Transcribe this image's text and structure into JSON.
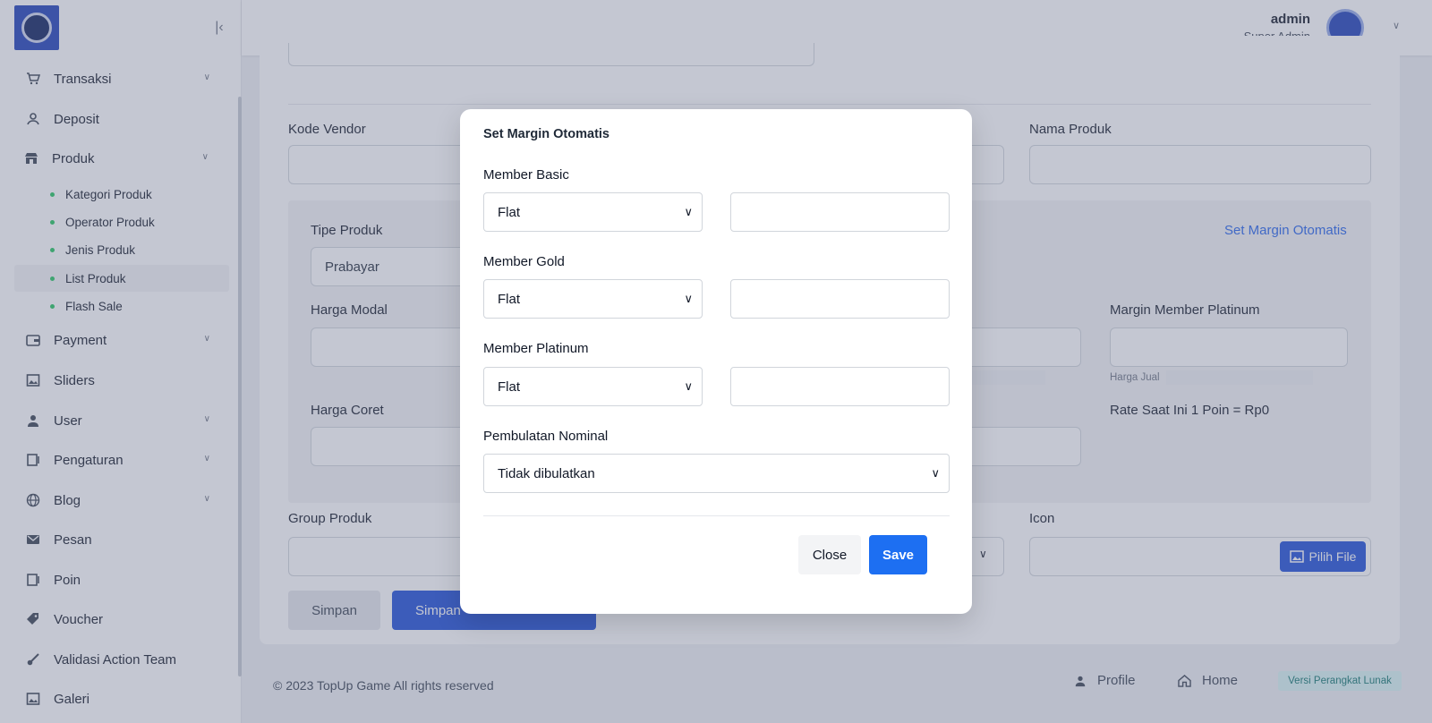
{
  "header": {
    "user_name": "admin",
    "user_role": "Super Admin"
  },
  "sidebar": {
    "items": [
      {
        "label": "Transaksi",
        "icon": "cart-icon",
        "has_submenu": true
      },
      {
        "label": "Deposit",
        "icon": "deposit-icon",
        "has_submenu": false
      },
      {
        "label": "Produk",
        "icon": "store-icon",
        "has_submenu": true
      },
      {
        "label": "Payment",
        "icon": "wallet-icon",
        "has_submenu": true
      },
      {
        "label": "Sliders",
        "icon": "image-icon",
        "has_submenu": false
      },
      {
        "label": "User",
        "icon": "user-icon",
        "has_submenu": true
      },
      {
        "label": "Pengaturan",
        "icon": "settings-icon",
        "has_submenu": true
      },
      {
        "label": "Blog",
        "icon": "globe-icon",
        "has_submenu": true
      },
      {
        "label": "Pesan",
        "icon": "mail-icon",
        "has_submenu": false
      },
      {
        "label": "Poin",
        "icon": "points-icon",
        "has_submenu": false
      },
      {
        "label": "Voucher",
        "icon": "tag-icon",
        "has_submenu": false
      },
      {
        "label": "Validasi Action Team",
        "icon": "brush-icon",
        "has_submenu": false
      },
      {
        "label": "Galeri",
        "icon": "gallery-icon",
        "has_submenu": false
      }
    ],
    "produk_submenu": [
      "Kategori Produk",
      "Operator Produk",
      "Jenis Produk",
      "List Produk",
      "Flash Sale"
    ],
    "active_submenu": "List Produk"
  },
  "form": {
    "kode_vendor_label": "Kode Vendor",
    "nama_produk_label": "Nama Produk",
    "tipe_produk_label": "Tipe Produk",
    "tipe_produk_value": "Prabayar",
    "set_margin_link": "Set Margin Otomatis",
    "harga_modal_label": "Harga Modal",
    "margin_platinum_label": "Margin Member Platinum",
    "harga_jual_hint": "Harga Jual",
    "harga_coret_label": "Harga Coret",
    "rate_text": "Rate Saat Ini 1 Poin = Rp0",
    "group_produk_label": "Group Produk",
    "icon_label": "Icon",
    "pilih_file_label": "Pilih File",
    "simpan_label": "Simpan",
    "simpan2_label": "Simpan"
  },
  "footer": {
    "copyright": "© 2023 TopUp Game All rights reserved",
    "profile_label": "Profile",
    "home_label": "Home",
    "version_badge": "Versi Perangkat Lunak"
  },
  "modal": {
    "title": "Set Margin Otomatis",
    "member_basic_label": "Member Basic",
    "member_basic_type": "Flat",
    "member_basic_value": "",
    "member_gold_label": "Member Gold",
    "member_gold_type": "Flat",
    "member_gold_value": "",
    "member_platinum_label": "Member Platinum",
    "member_platinum_type": "Flat",
    "member_platinum_value": "",
    "pembulatan_label": "Pembulatan Nominal",
    "pembulatan_value": "Tidak dibulatkan",
    "close_label": "Close",
    "save_label": "Save"
  }
}
